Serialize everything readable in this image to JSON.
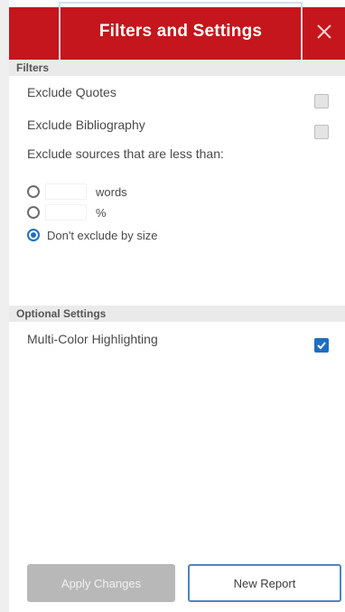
{
  "header": {
    "title": "Filters and Settings",
    "close_symbol": "×",
    "background_color": "#c4161c"
  },
  "filters": {
    "section_label": "Filters",
    "exclude_quotes": {
      "label": "Exclude Quotes",
      "checked": false
    },
    "exclude_bibliography": {
      "label": "Exclude Bibliography",
      "checked": false
    },
    "exclude_small_sources": {
      "label": "Exclude sources that are less than:",
      "options": [
        {
          "unit": "words",
          "value": "",
          "selected": false
        },
        {
          "unit": "%",
          "value": "",
          "selected": false
        },
        {
          "text": "Don't exclude by size",
          "selected": true
        }
      ]
    }
  },
  "optional_settings": {
    "section_label": "Optional Settings",
    "multi_color_highlighting": {
      "label": "Multi-Color Highlighting",
      "checked": true
    }
  },
  "footer": {
    "apply_label": "Apply Changes",
    "new_report_label": "New Report"
  },
  "colors": {
    "accent_blue": "#1f6fbf",
    "disabled_gray": "#b8b8b8"
  },
  "icons": {
    "close": "close-icon",
    "check": "checkmark-icon"
  }
}
